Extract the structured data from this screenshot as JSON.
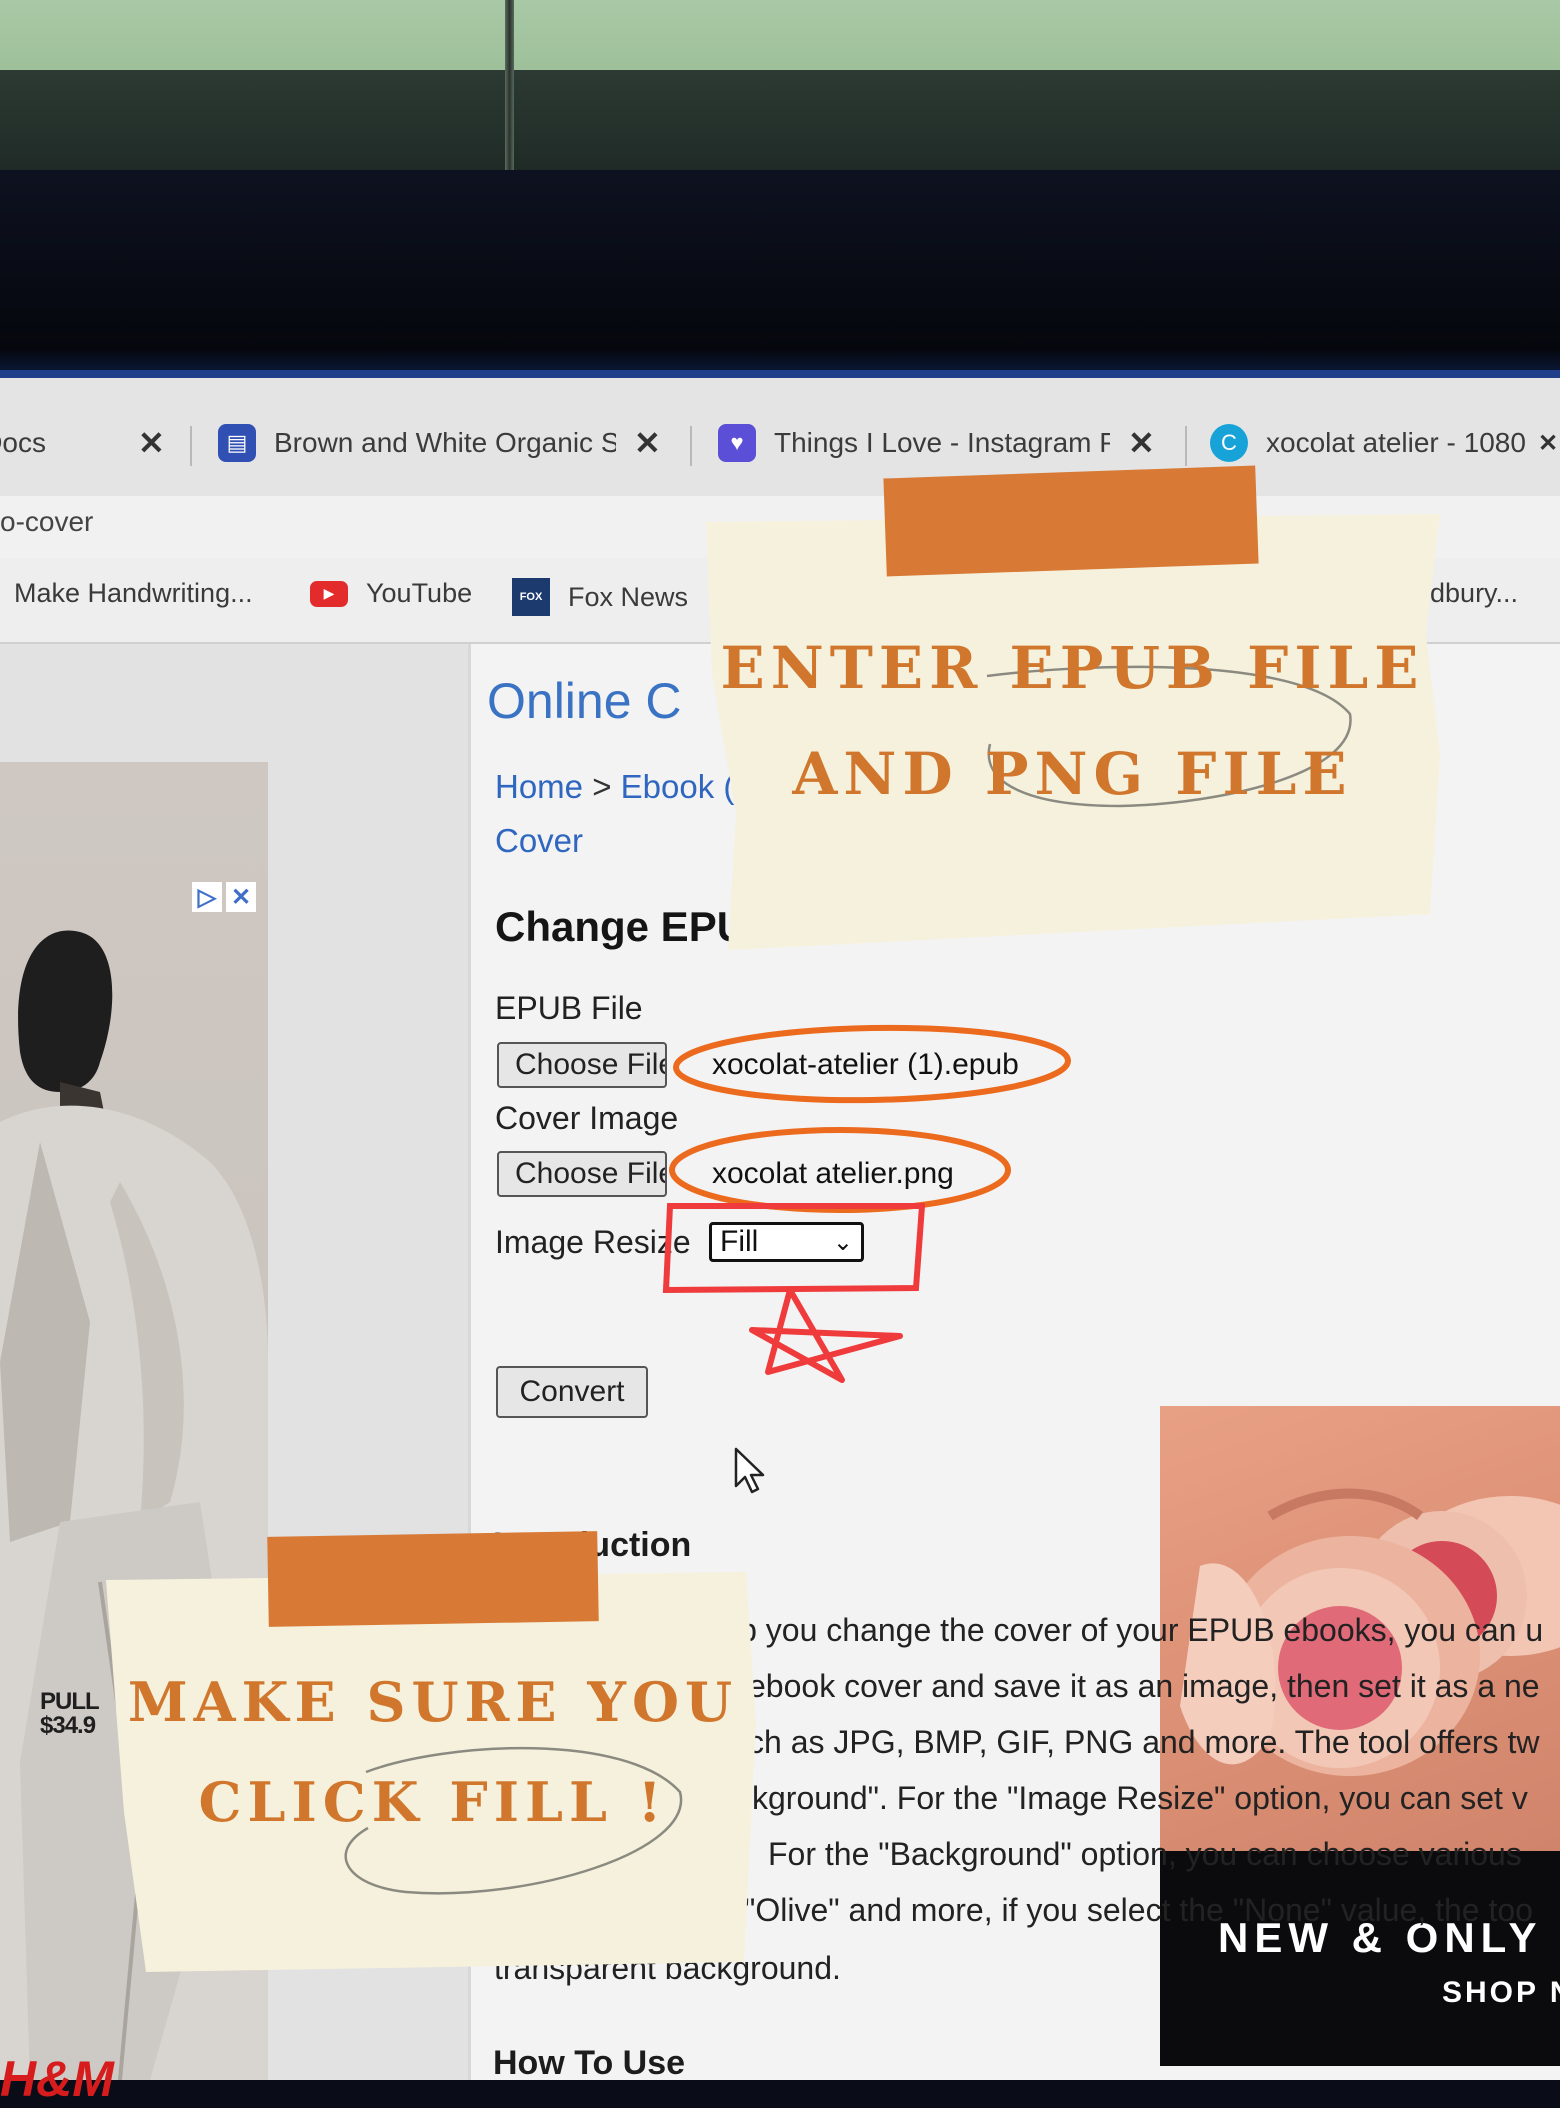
{
  "browser": {
    "tabs": [
      {
        "label": "Docs"
      },
      {
        "label": "Brown and White Organic S"
      },
      {
        "label": "Things I Love - Instagram P"
      },
      {
        "label": "xocolat atelier - 1080"
      }
    ],
    "address": "o-cover",
    "bookmarks": [
      {
        "label": "Make Handwriting..."
      },
      {
        "label": "YouTube"
      },
      {
        "label": "Fox News"
      },
      {
        "label": "odbury..."
      }
    ]
  },
  "page": {
    "title": "Online C",
    "breadcrumb": {
      "home": "Home",
      "separator": ">",
      "item": "Ebook (",
      "item2": "Cover"
    },
    "heading": "Change EPU",
    "form": {
      "epub_label": "EPUB File",
      "epub_button": "Choose File",
      "epub_filename": "xocolat-atelier (1).epub",
      "cover_label": "Cover Image",
      "cover_button": "Choose File",
      "cover_filename": "xocolat atelier.png",
      "resize_label": "Image Resize",
      "resize_value": "Fill",
      "convert_button": "Convert"
    },
    "introduction": {
      "heading": "Introduction",
      "lines": [
        "ip you change the cover of your EPUB ebooks, you can u",
        "ebook cover and save it as an image, then set it as a ne",
        "ch as JPG, BMP, GIF, PNG and more. The tool offers tw",
        "kground\". For the \"Image Resize\" option, you can set v",
        "For the \"Background\" option, you can choose various",
        "\"Olive\" and more, if you select the \"None\" value, the too",
        "transparent background."
      ]
    },
    "how_to_use": "How To Use"
  },
  "ads": {
    "left": {
      "price_line1": "PULL",
      "price_line2": "$34.9",
      "brand": "H&M"
    },
    "right": {
      "headline": "NEW & ONLY",
      "cta": "SHOP N"
    }
  },
  "notes": {
    "top": {
      "line1": "ENTER EPUB FILE",
      "line2": "AND PNG FILE"
    },
    "bottom": {
      "line1": "MAKE SURE YOU",
      "line2": "CLICK FILL !"
    }
  },
  "colors": {
    "link": "#2f66c0",
    "note_text": "#d0772d",
    "tape": "#d87a35",
    "circle_marker": "#ec6a1d",
    "red_marker": "#ef3b3b"
  }
}
